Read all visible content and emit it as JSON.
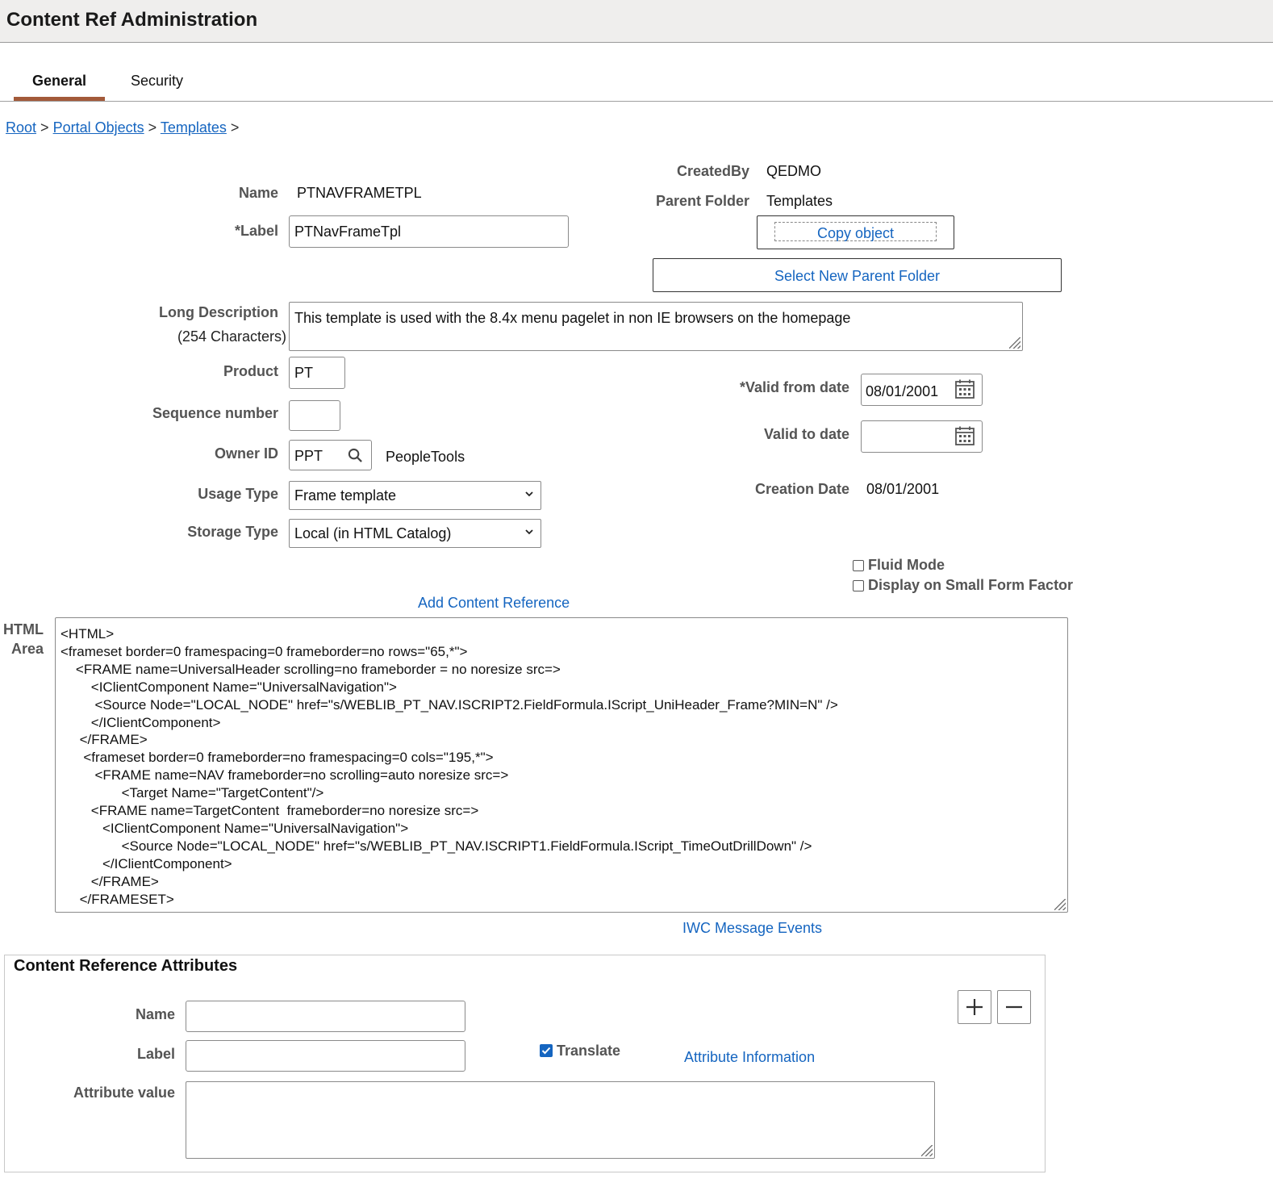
{
  "header": {
    "title": "Content Ref Administration"
  },
  "tabs": [
    {
      "label": "General"
    },
    {
      "label": "Security"
    }
  ],
  "breadcrumb": {
    "items": [
      "Root",
      "Portal Objects",
      "Templates"
    ],
    "sep": ">"
  },
  "form": {
    "name_label": "Name",
    "name_value": "PTNAVFRAMETPL",
    "label_label": "*Label",
    "label_value": "PTNavFrameTpl",
    "long_desc_label": "Long Description",
    "long_desc_sub": "(254 Characters)",
    "long_desc_value": "This template is used with the 8.4x menu pagelet in non IE browsers on the homepage",
    "product_label": "Product",
    "product_value": "PT",
    "sequence_label": "Sequence number",
    "sequence_value": "",
    "owner_label": "Owner ID",
    "owner_value": "PPT",
    "owner_desc": "PeopleTools",
    "usage_label": "Usage Type",
    "usage_value": "Frame template",
    "storage_label": "Storage Type",
    "storage_value": "Local (in HTML Catalog)"
  },
  "right": {
    "created_by_label": "CreatedBy",
    "created_by_value": "QEDMO",
    "parent_label": "Parent Folder",
    "parent_value": "Templates",
    "copy_button": "Copy object",
    "select_parent_button": "Select New Parent Folder",
    "valid_from_label": "*Valid from date",
    "valid_from_value": "08/01/2001",
    "valid_to_label": "Valid to date",
    "valid_to_value": "",
    "creation_label": "Creation Date",
    "creation_value": "08/01/2001",
    "fluid_mode": "Fluid Mode",
    "small_form": "Display on Small Form Factor"
  },
  "html_area": {
    "add_link": "Add Content Reference",
    "label_line1": "HTML",
    "label_line2": "Area",
    "lines": [
      "<HTML>",
      "<frameset border=0 framespacing=0 frameborder=no rows=\"65,*\">",
      "    <FRAME name=UniversalHeader scrolling=no frameborder = no noresize src=>",
      "        <IClientComponent Name=\"UniversalNavigation\">",
      "         <Source Node=\"LOCAL_NODE\" href=\"s/WEBLIB_PT_NAV.ISCRIPT2.FieldFormula.IScript_UniHeader_Frame?MIN=N\" />",
      "        </IClientComponent>",
      "     </FRAME>",
      "      <frameset border=0 frameborder=no framespacing=0 cols=\"195,*\">",
      "         <FRAME name=NAV frameborder=no scrolling=auto noresize src=>",
      "                <Target Name=\"TargetContent\"/>",
      "        <FRAME name=TargetContent  frameborder=no noresize src=>",
      "           <IClientComponent Name=\"UniversalNavigation\">",
      "                <Source Node=\"LOCAL_NODE\" href=\"s/WEBLIB_PT_NAV.ISCRIPT1.FieldFormula.IScript_TimeOutDrillDown\" />",
      "           </IClientComponent>",
      "        </FRAME>",
      "     </FRAMESET>",
      "   </FRAMESET>"
    ],
    "iwc_link": "IWC Message Events"
  },
  "attributes": {
    "title": "Content Reference Attributes",
    "name_label": "Name",
    "name_value": "",
    "label_label": "Label",
    "label_value": "",
    "translate_label": "Translate",
    "translate_checked": true,
    "info_link": "Attribute Information",
    "value_label": "Attribute value",
    "value_value": ""
  },
  "colors": {
    "link": "#1565c0",
    "tab_accent": "#a35a3a",
    "header_bg": "#efeeed"
  }
}
